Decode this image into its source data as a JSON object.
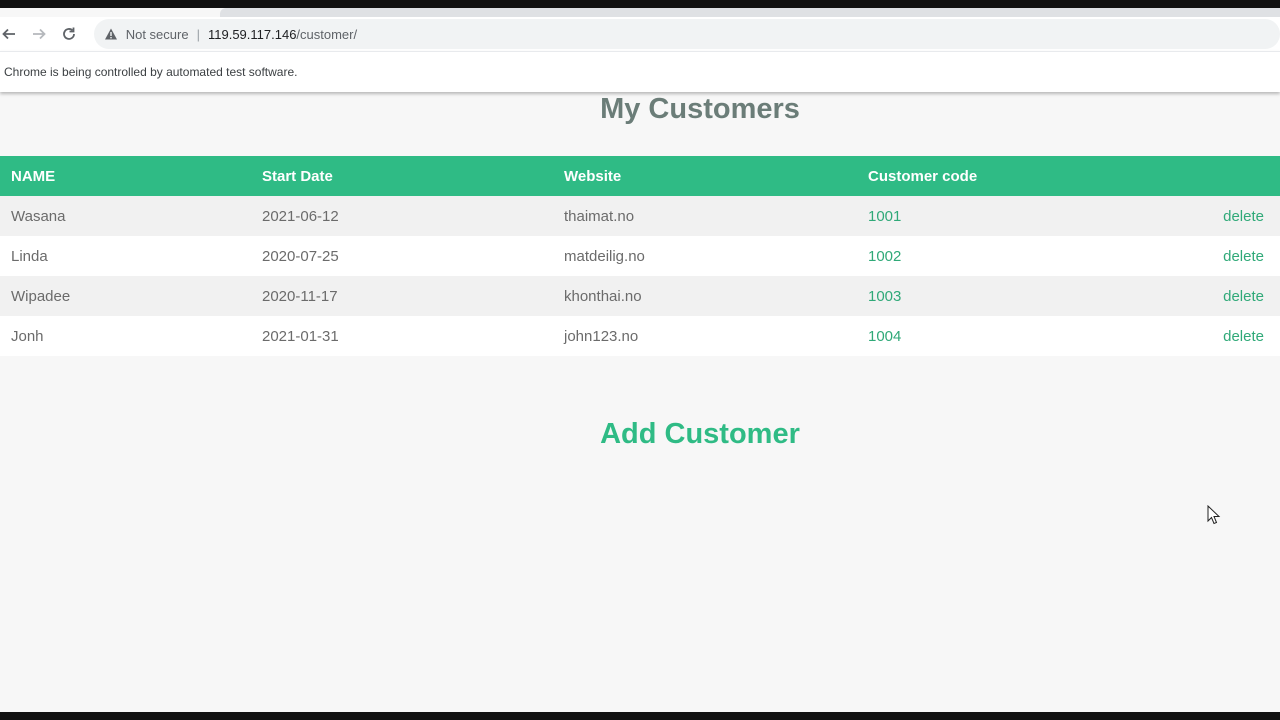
{
  "browser": {
    "security_label": "Not secure",
    "url_host": "119.59.117.146",
    "url_path": "/customer/",
    "infobar_text": "Chrome is being controlled by automated test software."
  },
  "page": {
    "title": "My Customers",
    "add_title": "Add Customer"
  },
  "table": {
    "headers": [
      "NAME",
      "Start Date",
      "Website",
      "Customer code"
    ],
    "rows": [
      {
        "name": "Wasana",
        "start_date": "2021-06-12",
        "website": "thaimat.no",
        "code": "1001",
        "action": "delete"
      },
      {
        "name": "Linda",
        "start_date": "2020-07-25",
        "website": "matdeilig.no",
        "code": "1002",
        "action": "delete"
      },
      {
        "name": "Wipadee",
        "start_date": "2020-11-17",
        "website": "khonthai.no",
        "code": "1003",
        "action": "delete"
      },
      {
        "name": "Jonh",
        "start_date": "2021-01-31",
        "website": "john123.no",
        "code": "1004",
        "action": "delete"
      }
    ]
  },
  "colors": {
    "accent": "#2fbb85",
    "title": "#6b7d78"
  }
}
